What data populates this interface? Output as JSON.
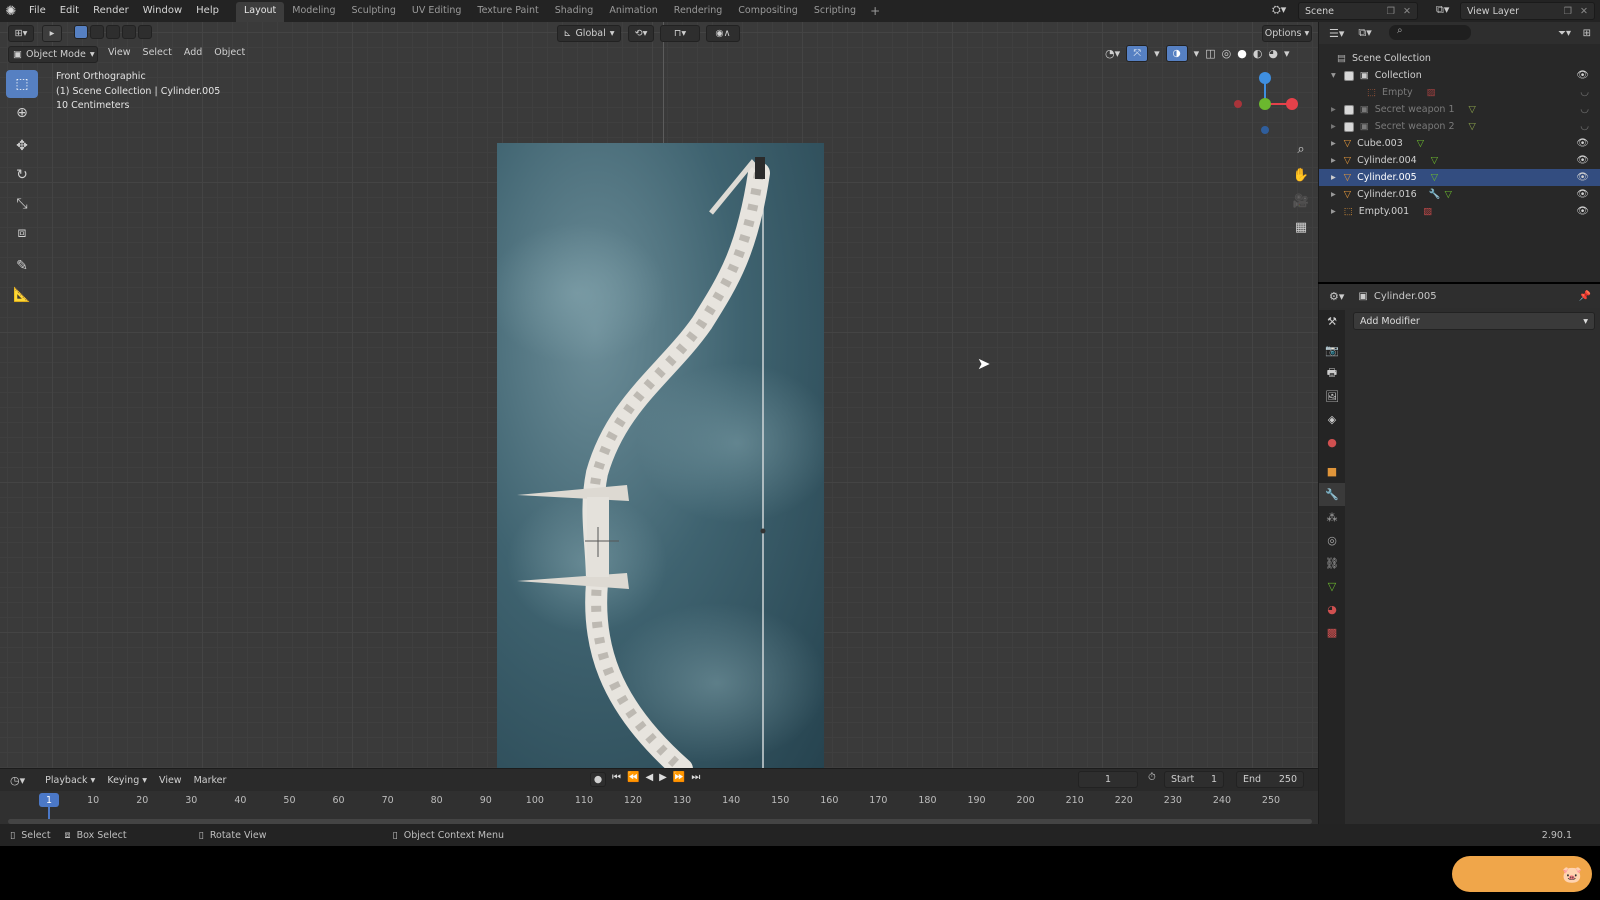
{
  "menubar": {
    "items": [
      "File",
      "Edit",
      "Render",
      "Window",
      "Help"
    ],
    "workspaces": [
      "Layout",
      "Modeling",
      "Sculpting",
      "UV Editing",
      "Texture Paint",
      "Shading",
      "Animation",
      "Rendering",
      "Compositing",
      "Scripting"
    ],
    "active_workspace": "Layout",
    "add_tab": "+",
    "scene_name": "Scene",
    "view_layer": "View Layer"
  },
  "viewport": {
    "mode": "Object Mode",
    "menus": [
      "View",
      "Select",
      "Add",
      "Object"
    ],
    "transform_orientation": "Global",
    "options_label": "Options",
    "overlay_lines": [
      "Front Orthographic",
      "(1) Scene Collection | Cylinder.005",
      "10 Centimeters"
    ]
  },
  "outliner": {
    "root": "Scene Collection",
    "rows": [
      {
        "name": "Collection",
        "type": "collection",
        "level": 1,
        "checked": true,
        "visible": true
      },
      {
        "name": "Empty",
        "type": "empty",
        "level": 2,
        "dim": true
      },
      {
        "name": "Secret weapon 1",
        "type": "collection",
        "level": 1,
        "checked": true,
        "dim": true
      },
      {
        "name": "Secret weapon 2",
        "type": "collection",
        "level": 1,
        "checked": true,
        "dim": true
      },
      {
        "name": "Cube.003",
        "type": "mesh",
        "level": 1,
        "visible": true
      },
      {
        "name": "Cylinder.004",
        "type": "mesh",
        "level": 1,
        "visible": true
      },
      {
        "name": "Cylinder.005",
        "type": "mesh",
        "level": 1,
        "visible": true,
        "selected": true
      },
      {
        "name": "Cylinder.016",
        "type": "mesh",
        "level": 1,
        "visible": true
      },
      {
        "name": "Empty.001",
        "type": "empty",
        "level": 1,
        "visible": true
      }
    ]
  },
  "properties": {
    "object_name": "Cylinder.005",
    "add_modifier_label": "Add Modifier",
    "active_tab": "modifiers"
  },
  "timeline": {
    "menus": [
      "Playback",
      "Keying",
      "View",
      "Marker"
    ],
    "current_frame": "1",
    "start_label": "Start",
    "start": "1",
    "end_label": "End",
    "end": "250",
    "ticks": [
      "1",
      "10",
      "20",
      "30",
      "40",
      "50",
      "60",
      "70",
      "80",
      "90",
      "100",
      "110",
      "120",
      "130",
      "140",
      "150",
      "160",
      "170",
      "180",
      "190",
      "200",
      "210",
      "220",
      "230",
      "240",
      "250"
    ]
  },
  "statusbar": {
    "select": "Select",
    "box_select": "Box Select",
    "rotate_view": "Rotate View",
    "context_menu": "Object Context Menu",
    "version": "2.90.1"
  },
  "colors": {
    "accent": "#5680c2",
    "selection": "#334d80",
    "x_axis": "#e5414a",
    "y_axis": "#6bb82e",
    "z_axis": "#3f8fe0"
  }
}
